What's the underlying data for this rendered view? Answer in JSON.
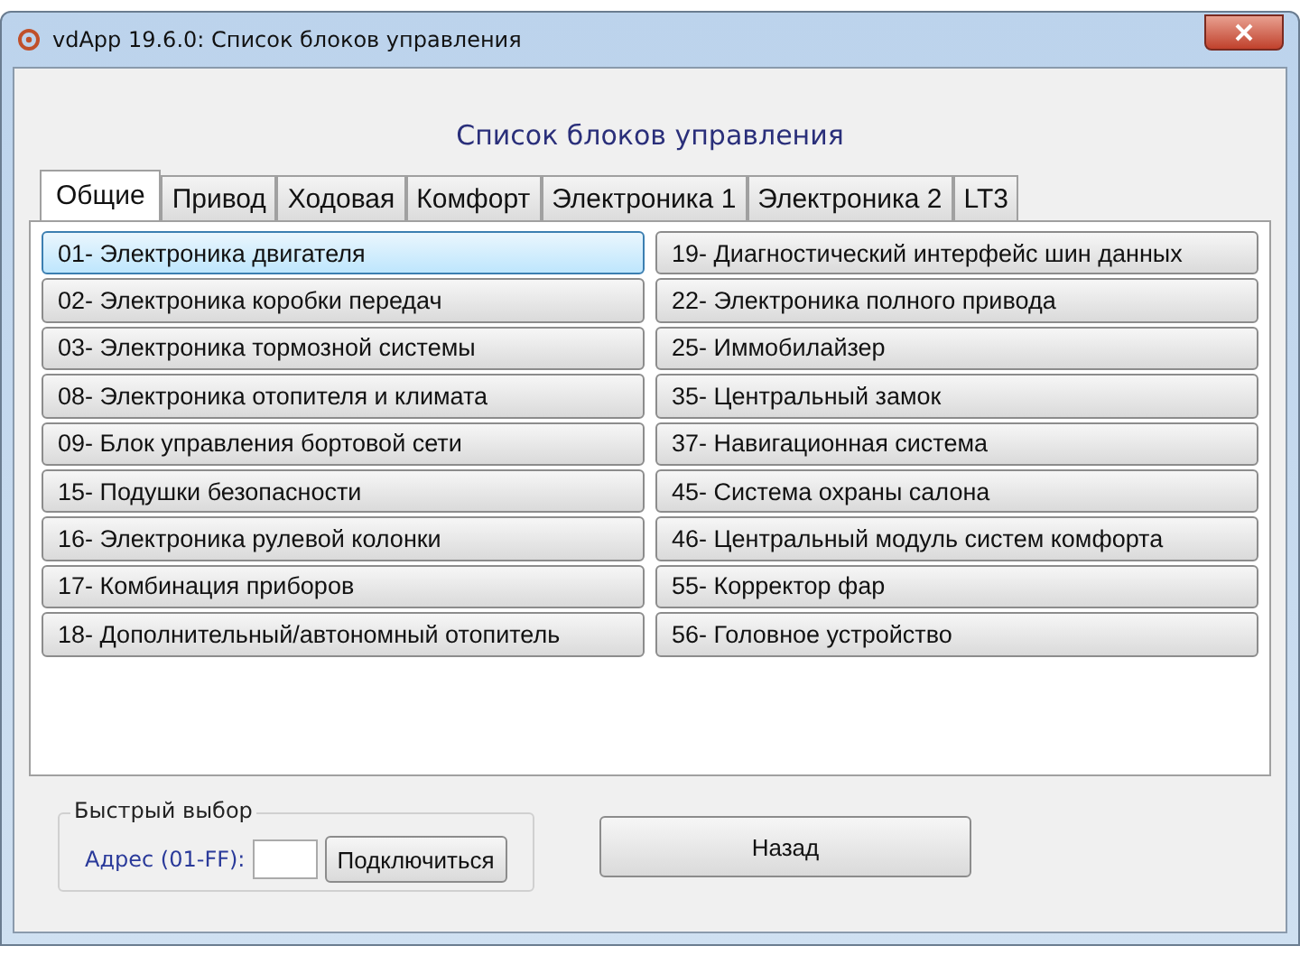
{
  "window": {
    "title": "vdApp 19.6.0:  Список блоков управления"
  },
  "heading": "Список блоков управления",
  "tabs": [
    {
      "label": "Общие",
      "selected": true
    },
    {
      "label": "Привод",
      "selected": false
    },
    {
      "label": "Ходовая",
      "selected": false
    },
    {
      "label": "Комфорт",
      "selected": false
    },
    {
      "label": "Электроника 1",
      "selected": false
    },
    {
      "label": "Электроника 2",
      "selected": false
    },
    {
      "label": "LT3",
      "selected": false
    }
  ],
  "columns": [
    [
      {
        "label": "01- Электроника двигателя",
        "selected": true
      },
      {
        "label": "02- Электроника коробки передач",
        "selected": false
      },
      {
        "label": "03- Электроника тормозной системы",
        "selected": false
      },
      {
        "label": "08- Электроника отопителя и климата",
        "selected": false
      },
      {
        "label": "09- Блок управления бортовой сети",
        "selected": false
      },
      {
        "label": "15- Подушки безопасности",
        "selected": false
      },
      {
        "label": "16- Электроника рулевой колонки",
        "selected": false
      },
      {
        "label": "17- Комбинация приборов",
        "selected": false
      },
      {
        "label": "18- Дополнительный/автономный отопитель",
        "selected": false
      }
    ],
    [
      {
        "label": "19- Диагностический интерфейс шин данных",
        "selected": false
      },
      {
        "label": "22- Электроника полного привода",
        "selected": false
      },
      {
        "label": "25- Иммобилайзер",
        "selected": false
      },
      {
        "label": "35- Центральный замок",
        "selected": false
      },
      {
        "label": "37- Навигационная система",
        "selected": false
      },
      {
        "label": "45- Система охраны салона",
        "selected": false
      },
      {
        "label": "46- Центральный модуль систем комфорта",
        "selected": false
      },
      {
        "label": "55- Корректор фар",
        "selected": false
      },
      {
        "label": "56- Головное устройство",
        "selected": false
      }
    ]
  ],
  "quick_select": {
    "title": "Быстрый выбор",
    "address_label": "Адрес (01-FF):",
    "connect_button": "Подключиться"
  },
  "back_button": "Назад"
}
